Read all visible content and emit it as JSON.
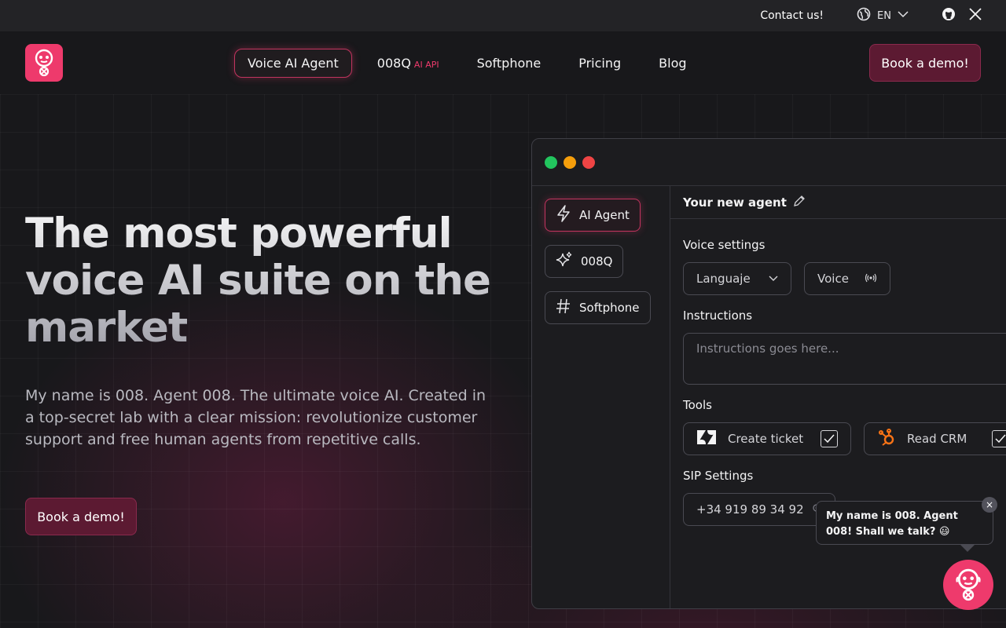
{
  "topbar": {
    "contact": "Contact us!",
    "language": "EN",
    "icons": [
      "globe-icon",
      "chevron-down-icon",
      "github-icon",
      "x-icon"
    ]
  },
  "brand": {
    "logo_icon": "agent-008-logo-icon",
    "accent": "#ee3a6c"
  },
  "nav": {
    "items": [
      {
        "label": "Voice AI Agent",
        "active": true
      },
      {
        "label": "008Q",
        "tag": "AI API"
      },
      {
        "label": "Softphone"
      },
      {
        "label": "Pricing"
      },
      {
        "label": "Blog"
      }
    ],
    "cta": "Book a demo!"
  },
  "hero": {
    "title": "The most powerful voice AI suite on the market",
    "subtitle": "My name is 008. Agent 008. The ultimate voice AI. Created in a top-secret lab with a clear mission: revolutionize customer support and free human agents from repetitive calls.",
    "cta": "Book a demo!"
  },
  "app": {
    "window_dots": [
      "#22c55e",
      "#f59e0b",
      "#ef4444"
    ],
    "sidebar": [
      {
        "label": "AI Agent",
        "icon": "lightning-icon",
        "active": true
      },
      {
        "label": "008Q",
        "icon": "sparkles-icon"
      },
      {
        "label": "Softphone",
        "icon": "hash-icon"
      }
    ],
    "agent_name": "Your new agent",
    "voice_settings": {
      "label": "Voice settings",
      "language": "Languaje",
      "voice": "Voice"
    },
    "instructions": {
      "label": "Instructions",
      "placeholder": "Instructions goes here..."
    },
    "tools": {
      "label": "Tools",
      "items": [
        {
          "label": "Create ticket",
          "icon": "zendesk-icon",
          "checked": true
        },
        {
          "label": "Read CRM",
          "icon": "hubspot-icon",
          "checked": true
        }
      ]
    },
    "sip": {
      "label": "SIP Settings",
      "number": "+34 919 89 34 92"
    }
  },
  "chat": {
    "message": "My name is 008. Agent 008! Shall we talk? 😃",
    "close": "×"
  }
}
